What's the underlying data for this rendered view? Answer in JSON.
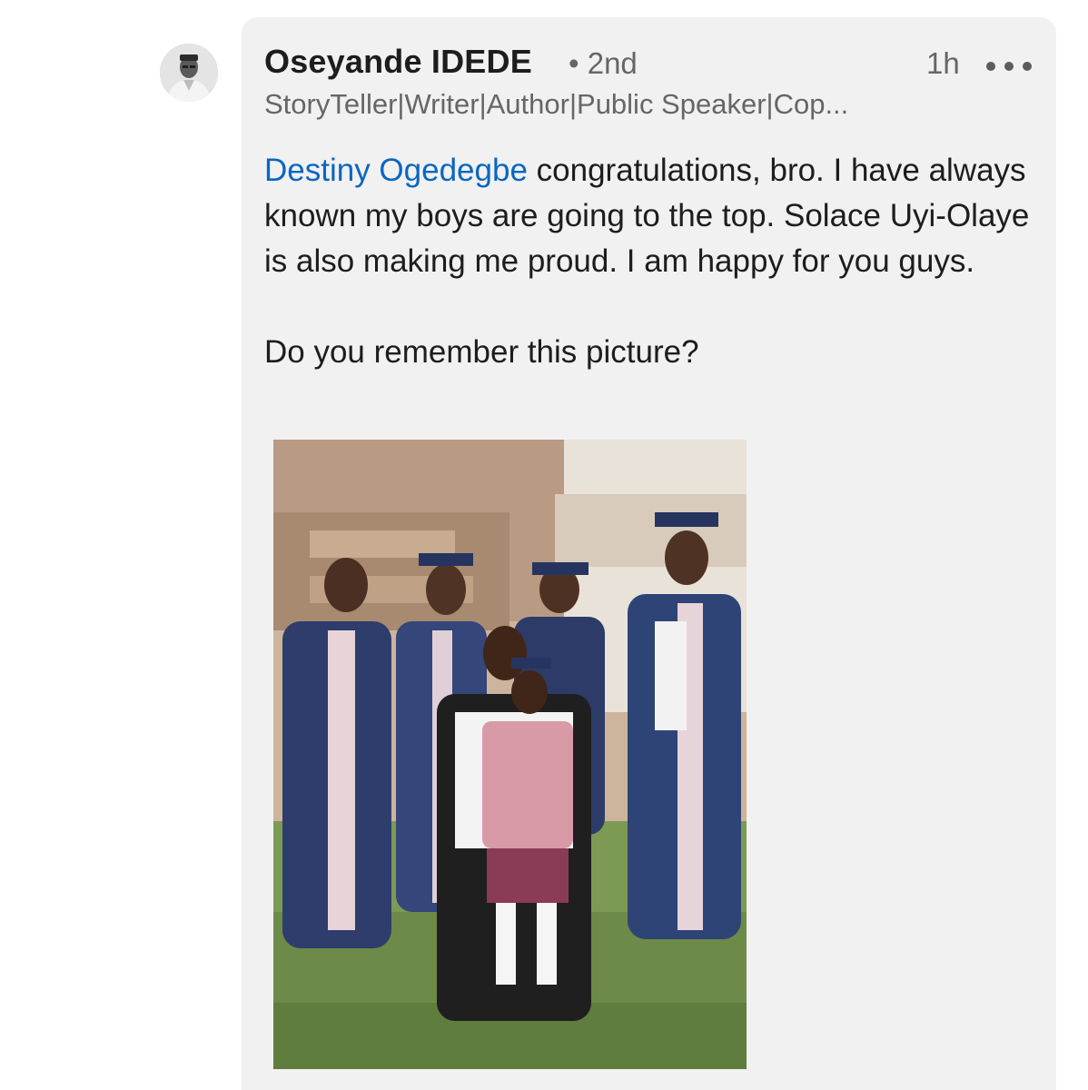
{
  "comment": {
    "author": {
      "name": "Oseyande IDEDE",
      "degree": "• 2nd",
      "headline": "StoryTeller|Writer|Author|Public Speaker|Cop..."
    },
    "time": "1h",
    "more_icon": "ellipsis-icon",
    "body": {
      "mention": "Destiny Ogedegbe",
      "line1_rest": " congratulations, bro. I have always known my boys are going to the top. Solace Uyi-Olaye is also making me proud. I am happy for you guys.",
      "line2": "Do you remember this picture?"
    }
  },
  "colors": {
    "card_background": "#f1f1f1",
    "mention_link": "#0a66c2",
    "primary_text": "#1d1d1d",
    "secondary_text": "#666666"
  }
}
